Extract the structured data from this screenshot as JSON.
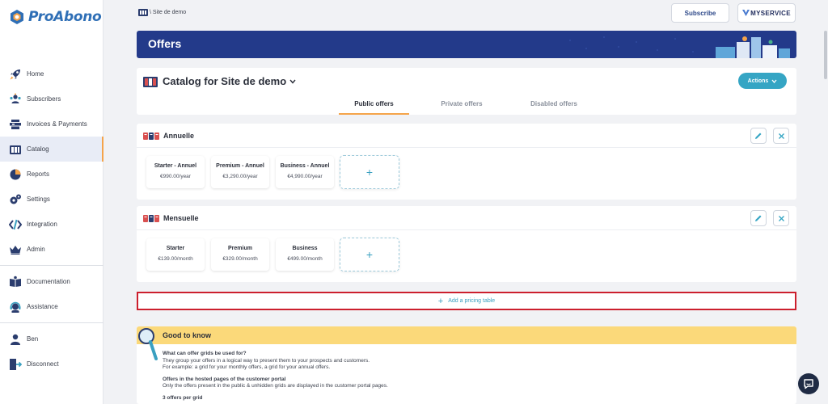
{
  "app": {
    "name": "ProAbono"
  },
  "sidebar": {
    "items": [
      {
        "label": "Home",
        "icon": "rocket-icon"
      },
      {
        "label": "Subscribers",
        "icon": "users-icon"
      },
      {
        "label": "Invoices & Payments",
        "icon": "invoices-icon"
      },
      {
        "label": "Catalog",
        "icon": "catalog-icon",
        "active": true
      },
      {
        "label": "Reports",
        "icon": "pie-chart-icon"
      },
      {
        "label": "Settings",
        "icon": "gears-icon"
      },
      {
        "label": "Integration",
        "icon": "code-icon"
      },
      {
        "label": "Admin",
        "icon": "crown-icon"
      }
    ],
    "secondary": [
      {
        "label": "Documentation",
        "icon": "book-icon"
      },
      {
        "label": "Assistance",
        "icon": "headset-icon"
      }
    ],
    "user": [
      {
        "label": "Ben",
        "icon": "user-icon"
      },
      {
        "label": "Disconnect",
        "icon": "logout-icon"
      }
    ]
  },
  "header": {
    "breadcrumb": "\\ Site de demo",
    "subscribe_label": "Subscribe",
    "brand_label": "MYSERVICE"
  },
  "banner": {
    "title": "Offers"
  },
  "catalog": {
    "title": "Catalog for Site de demo",
    "actions_label": "Actions",
    "tabs": [
      {
        "label": "Public offers",
        "active": true
      },
      {
        "label": "Private offers",
        "active": false
      },
      {
        "label": "Disabled offers",
        "active": false
      }
    ]
  },
  "grids": [
    {
      "name": "Annuelle",
      "offers": [
        {
          "name": "Starter - Annuel",
          "price": "€990.00/year"
        },
        {
          "name": "Premium - Annuel",
          "price": "€3,290.00/year"
        },
        {
          "name": "Business - Annuel",
          "price": "€4,990.00/year"
        }
      ],
      "add_label": "+"
    },
    {
      "name": "Mensuelle",
      "offers": [
        {
          "name": "Starter",
          "price": "€139.00/month"
        },
        {
          "name": "Premium",
          "price": "€329.00/month"
        },
        {
          "name": "Business",
          "price": "€499.00/month"
        }
      ],
      "add_label": "+"
    }
  ],
  "add_pricing": {
    "plus": "+",
    "label": "Add a pricing table"
  },
  "good_to_know": {
    "title": "Good to know",
    "blocks": [
      {
        "q": "What can offer grids be used for?",
        "lines": [
          "They group your offers in a logical way to present them to your prospects and customers.",
          "For example: a grid for your monthly offers, a grid for your annual offers."
        ]
      },
      {
        "q": "Offers in the hosted pages of the customer portal",
        "lines": [
          "Only the offers present in the public & unhidden grids are displayed in the customer portal pages."
        ]
      },
      {
        "q": "3 offers per grid",
        "lines": []
      }
    ]
  },
  "colors": {
    "accent": "#f5a44a",
    "primary": "#233a8a",
    "teal": "#35a5c4",
    "highlight_border": "#cc1f2d",
    "notice": "#fbd97a"
  }
}
